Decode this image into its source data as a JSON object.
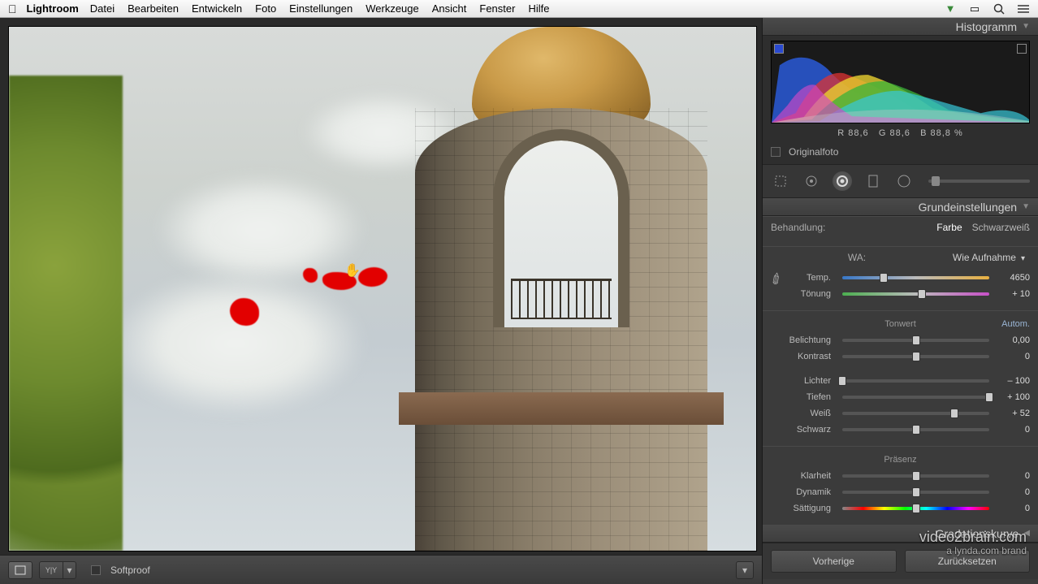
{
  "menubar": {
    "app": "Lightroom",
    "items": [
      "Datei",
      "Bearbeiten",
      "Entwickeln",
      "Foto",
      "Einstellungen",
      "Werkzeuge",
      "Ansicht",
      "Fenster",
      "Hilfe"
    ]
  },
  "panel": {
    "histogram_title": "Histogramm",
    "rgb": {
      "r_label": "R",
      "r": "88,6",
      "g_label": "G",
      "g": "88,6",
      "b_label": "B",
      "b": "88,8",
      "pct": "%"
    },
    "original": "Originalfoto",
    "basic_title": "Grundeinstellungen",
    "treatment": {
      "label": "Behandlung:",
      "color": "Farbe",
      "bw": "Schwarzweiß"
    },
    "wa": {
      "label": "WA:",
      "preset": "Wie Aufnahme"
    },
    "sliders": {
      "temp": {
        "label": "Temp.",
        "value": "4650",
        "pos": 28
      },
      "tint": {
        "label": "Tönung",
        "value": "+ 10",
        "pos": 54
      },
      "tone_title": "Tonwert",
      "auto": "Autom.",
      "exposure": {
        "label": "Belichtung",
        "value": "0,00",
        "pos": 50
      },
      "contrast": {
        "label": "Kontrast",
        "value": "0",
        "pos": 50
      },
      "highlights": {
        "label": "Lichter",
        "value": "– 100",
        "pos": 0
      },
      "shadows": {
        "label": "Tiefen",
        "value": "+ 100",
        "pos": 100
      },
      "white": {
        "label": "Weiß",
        "value": "+ 52",
        "pos": 76
      },
      "black": {
        "label": "Schwarz",
        "value": "0",
        "pos": 50
      },
      "presence_title": "Präsenz",
      "clarity": {
        "label": "Klarheit",
        "value": "0",
        "pos": 50
      },
      "vibrance": {
        "label": "Dynamik",
        "value": "0",
        "pos": 50
      },
      "saturation": {
        "label": "Sättigung",
        "value": "0",
        "pos": 50
      }
    },
    "tonecurve_title": "Gradationskurve",
    "buttons": {
      "prev": "Vorherige",
      "reset": "Zurücksetzen"
    }
  },
  "bottom": {
    "softproof": "Softproof"
  },
  "watermark": {
    "line1": "video2brain.com",
    "line2": "a lynda.com brand"
  }
}
